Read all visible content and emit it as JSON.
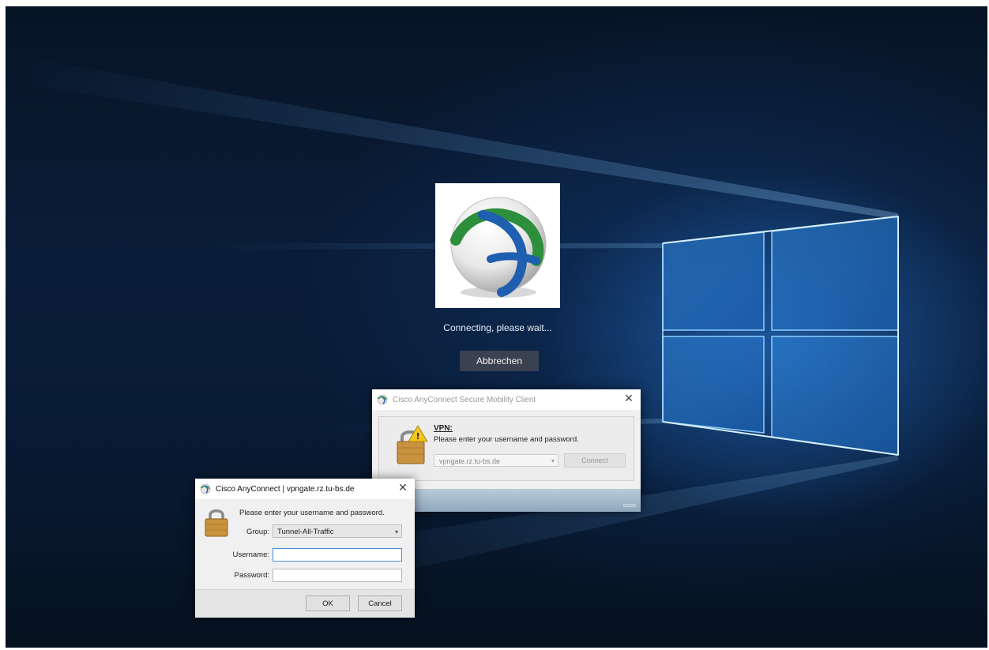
{
  "splash": {
    "status_text": "Connecting, please wait...",
    "cancel_label": "Abbrechen"
  },
  "vpn_window": {
    "title": "Cisco AnyConnect Secure Mobility Client",
    "heading": "VPN:",
    "message": "Please enter your username and password.",
    "server_value": "vpngate.rz.tu-bs.de",
    "connect_label": "Connect",
    "close_glyph": "✕",
    "footer_stamp": "cisco"
  },
  "login_window": {
    "title": "Cisco AnyConnect | vpngate.rz.tu-bs.de",
    "message": "Please enter your username and password.",
    "group_label": "Group:",
    "group_value": "Tunnel-All-Traffic",
    "username_label": "Username:",
    "username_value": "",
    "password_label": "Password:",
    "password_value": "",
    "ok_label": "OK",
    "cancel_label": "Cancel",
    "close_glyph": "✕"
  },
  "colors": {
    "desktop_bg": "#0a1d38",
    "light_blue": "#3b8fe0",
    "focus_border": "#4a90d9"
  },
  "icons": [
    "anyconnect-logo",
    "windows-logo",
    "lock-warning-icon",
    "lock-icon",
    "close-icon",
    "chevron-down-icon"
  ]
}
